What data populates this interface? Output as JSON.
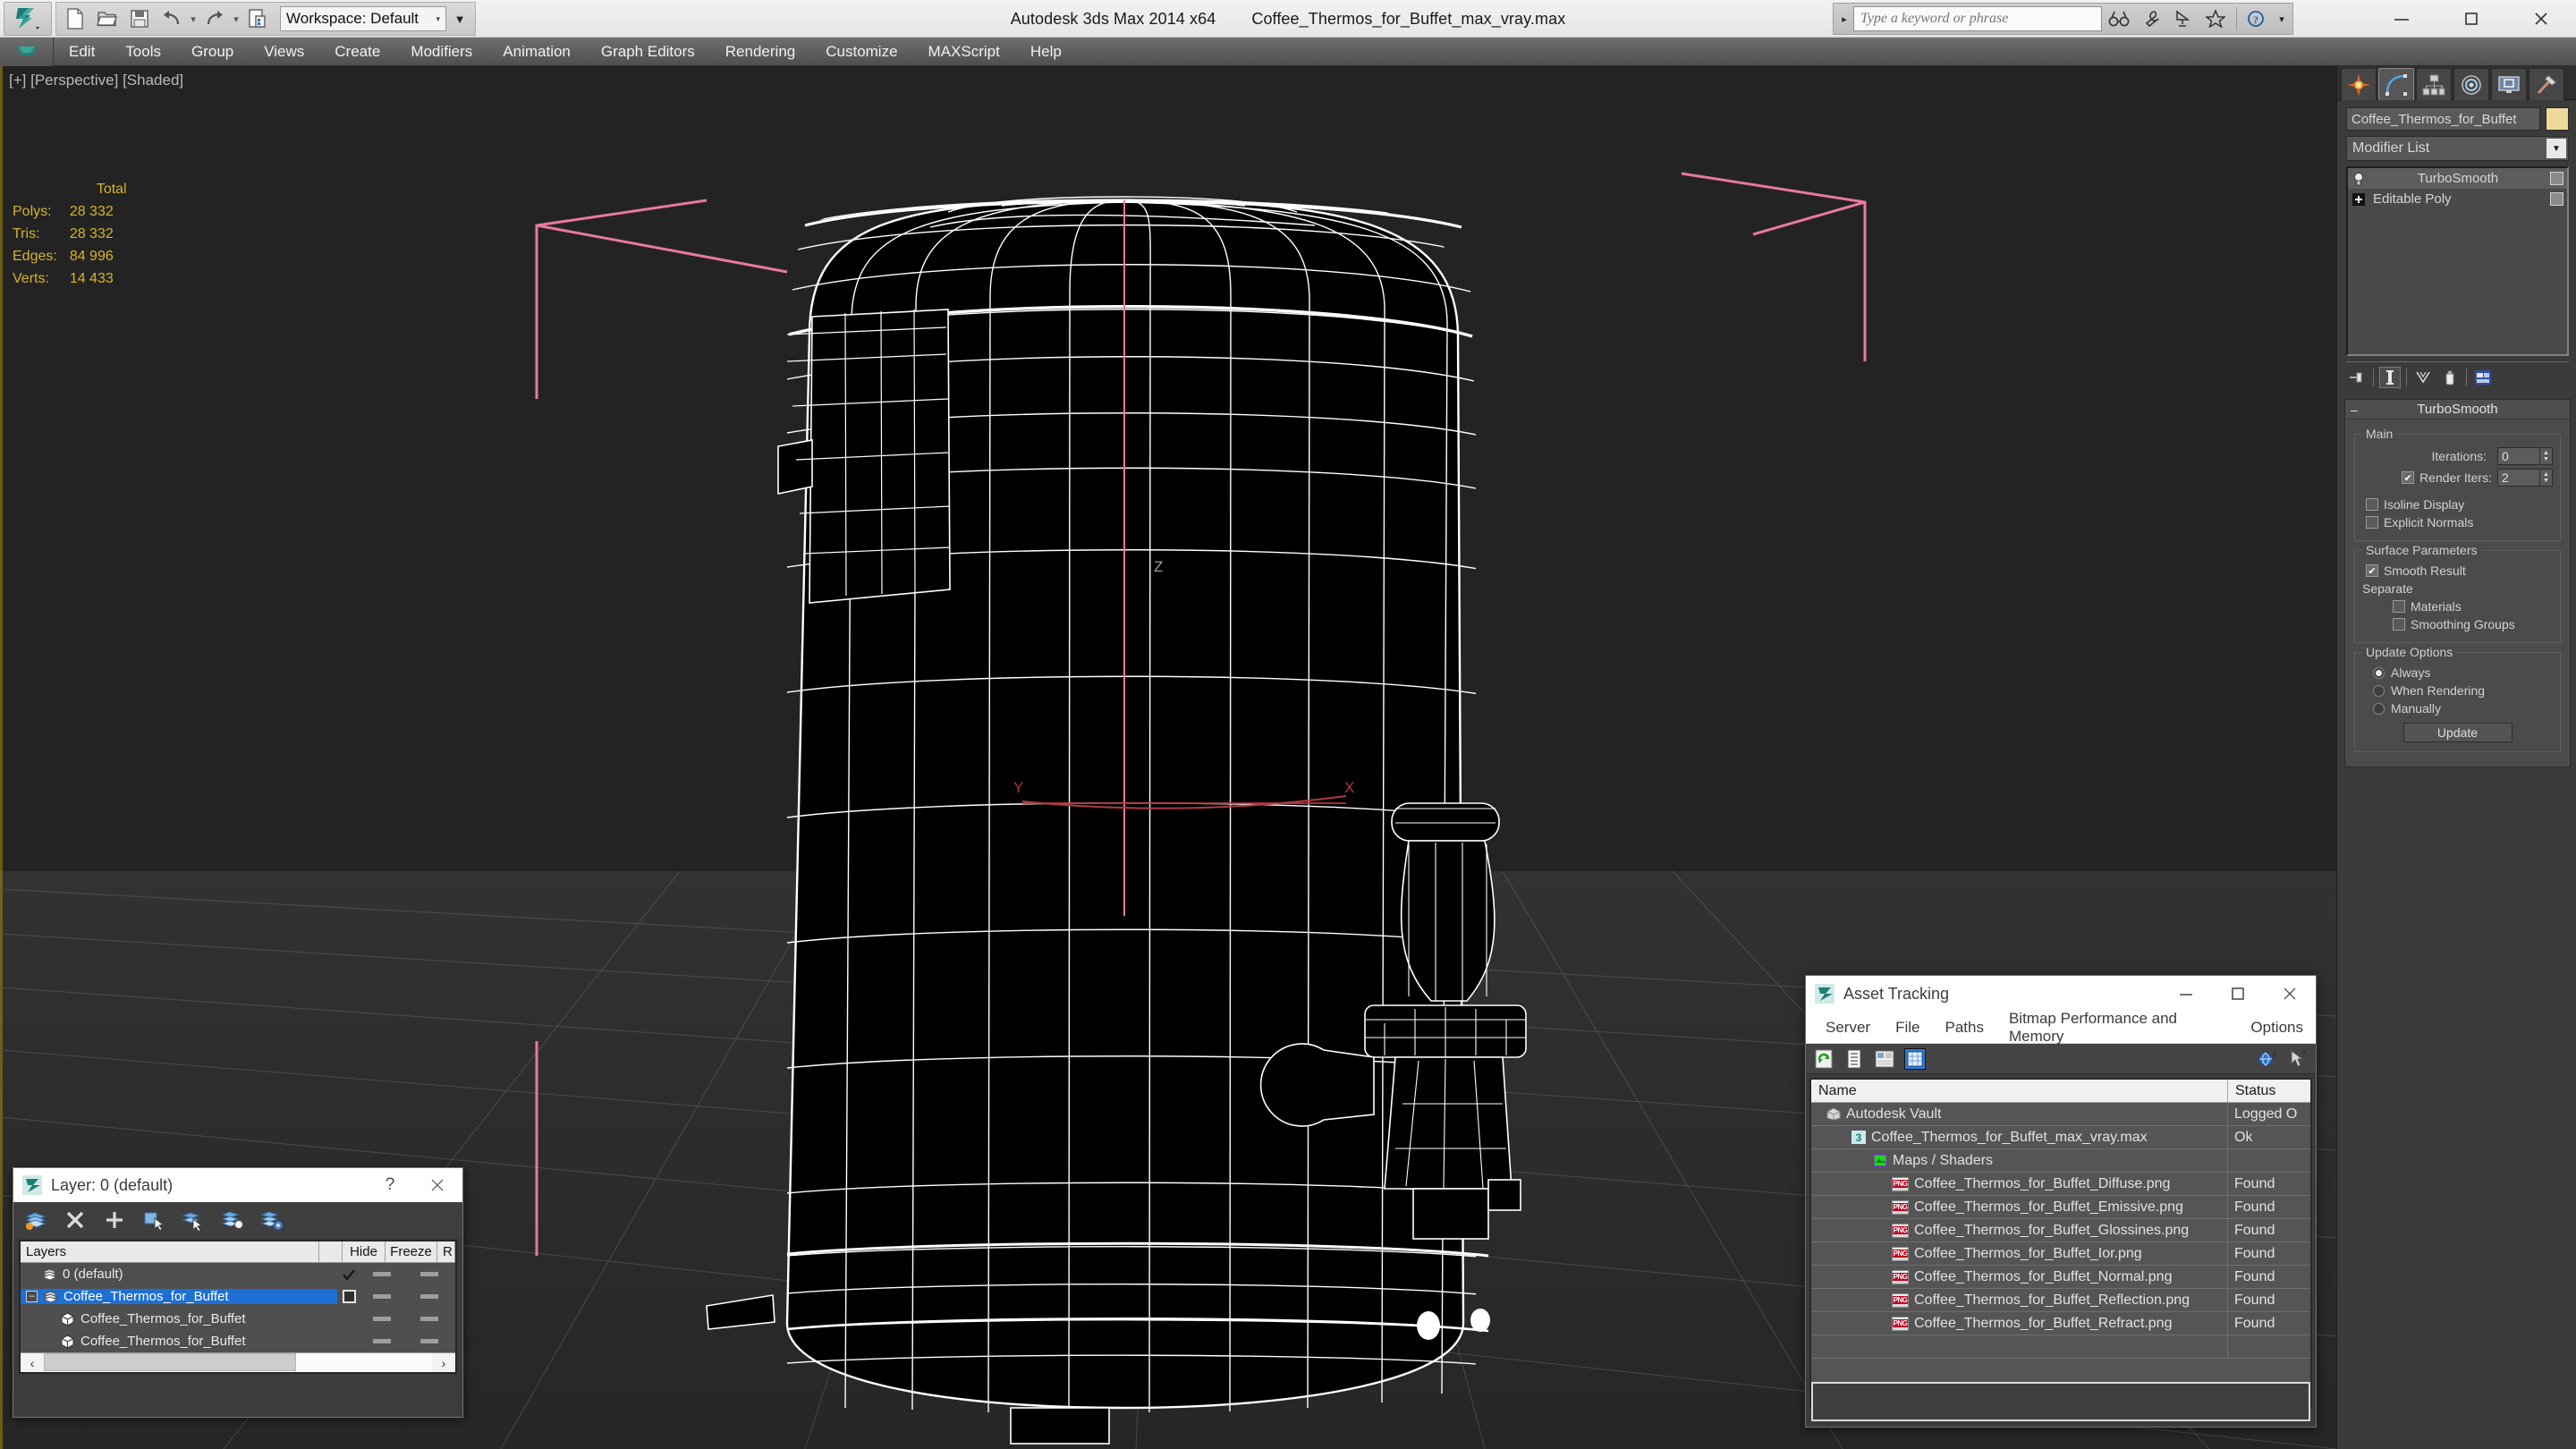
{
  "titlebar": {
    "app_title": "Autodesk 3ds Max  2014 x64",
    "file_title": "Coffee_Thermos_for_Buffet_max_vray.max",
    "workspace_label": "Workspace: Default",
    "search_placeholder": "Type a keyword or phrase",
    "quick_access": [
      {
        "name": "new-file",
        "label": "New"
      },
      {
        "name": "open-file",
        "label": "Open"
      },
      {
        "name": "save-file",
        "label": "Save"
      },
      {
        "name": "undo",
        "label": "Undo"
      },
      {
        "name": "redo",
        "label": "Redo"
      },
      {
        "name": "set-project-folder",
        "label": "Set Project Folder"
      }
    ],
    "help_icons": [
      "binoculars-icon",
      "wrench-icon",
      "satellite-icon",
      "star-icon",
      "help-icon"
    ],
    "window_controls": {
      "minimize": "–",
      "maximize": "☐",
      "close": "✕"
    }
  },
  "menubar": {
    "items": [
      "Edit",
      "Tools",
      "Group",
      "Views",
      "Create",
      "Modifiers",
      "Animation",
      "Graph Editors",
      "Rendering",
      "Customize",
      "MAXScript",
      "Help"
    ]
  },
  "viewport": {
    "label": "[+] [Perspective] [Shaded]",
    "stats": {
      "header": "Total",
      "rows": [
        {
          "label": "Polys:",
          "value": "28 332"
        },
        {
          "label": "Tris:",
          "value": "28 332"
        },
        {
          "label": "Edges:",
          "value": "84 996"
        },
        {
          "label": "Verts:",
          "value": "14 433"
        }
      ]
    },
    "axis_labels": {
      "z": "Z",
      "x": "X",
      "y": "Y"
    },
    "colors": {
      "background": "#232323",
      "wireframe": "#ffffff",
      "selection_bracket": "#e8799f",
      "grid": "#3a3a3a",
      "stats_text": "#d4b42a"
    }
  },
  "command_panel": {
    "tabs": [
      {
        "name": "create-tab",
        "label": "Create"
      },
      {
        "name": "modify-tab",
        "label": "Modify",
        "active": true
      },
      {
        "name": "hierarchy-tab",
        "label": "Hierarchy"
      },
      {
        "name": "motion-tab",
        "label": "Motion"
      },
      {
        "name": "display-tab",
        "label": "Display"
      },
      {
        "name": "utilities-tab",
        "label": "Utilities"
      }
    ],
    "object_name": "Coffee_Thermos_for_Buffet",
    "object_color": "#efd99a",
    "modifier_list_label": "Modifier List",
    "stack": [
      {
        "label": "TurboSmooth",
        "selected": true
      },
      {
        "label": "Editable Poly",
        "selected": false
      }
    ],
    "rollout": {
      "title": "TurboSmooth",
      "main_group": "Main",
      "iterations_label": "Iterations:",
      "iterations_value": "0",
      "render_iters_label": "Render Iters:",
      "render_iters_value": "2",
      "render_iters_checked": true,
      "isoline_label": "Isoline Display",
      "isoline_checked": false,
      "explicit_normals_label": "Explicit Normals",
      "explicit_normals_checked": false,
      "surface_group": "Surface Parameters",
      "smooth_result_label": "Smooth Result",
      "smooth_result_checked": true,
      "separate_label": "Separate",
      "materials_label": "Materials",
      "materials_checked": false,
      "smoothing_groups_label": "Smoothing Groups",
      "smoothing_groups_checked": false,
      "update_group": "Update Options",
      "update_options": [
        {
          "label": "Always",
          "selected": true
        },
        {
          "label": "When Rendering",
          "selected": false
        },
        {
          "label": "Manually",
          "selected": false
        }
      ],
      "update_button": "Update"
    }
  },
  "asset_tracking": {
    "title": "Asset Tracking",
    "menu": [
      "Server",
      "File",
      "Paths",
      "Bitmap Performance and Memory",
      "Options"
    ],
    "columns": {
      "name": "Name",
      "status": "Status"
    },
    "rows": [
      {
        "indent": 0,
        "icon": "vault-icon",
        "name": "Autodesk Vault",
        "status": "Logged O"
      },
      {
        "indent": 1,
        "icon": "max-icon",
        "name": "Coffee_Thermos_for_Buffet_max_vray.max",
        "status": "Ok"
      },
      {
        "indent": 2,
        "icon": "maps-icon",
        "name": "Maps / Shaders",
        "status": ""
      },
      {
        "indent": 3,
        "icon": "png-icon",
        "name": "Coffee_Thermos_for_Buffet_Diffuse.png",
        "status": "Found"
      },
      {
        "indent": 3,
        "icon": "png-icon",
        "name": "Coffee_Thermos_for_Buffet_Emissive.png",
        "status": "Found"
      },
      {
        "indent": 3,
        "icon": "png-icon",
        "name": "Coffee_Thermos_for_Buffet_Glossines.png",
        "status": "Found"
      },
      {
        "indent": 3,
        "icon": "png-icon",
        "name": "Coffee_Thermos_for_Buffet_Ior.png",
        "status": "Found"
      },
      {
        "indent": 3,
        "icon": "png-icon",
        "name": "Coffee_Thermos_for_Buffet_Normal.png",
        "status": "Found"
      },
      {
        "indent": 3,
        "icon": "png-icon",
        "name": "Coffee_Thermos_for_Buffet_Reflection.png",
        "status": "Found"
      },
      {
        "indent": 3,
        "icon": "png-icon",
        "name": "Coffee_Thermos_for_Buffet_Refract.png",
        "status": "Found"
      }
    ],
    "window_controls": {
      "minimize": "–",
      "maximize": "☐",
      "close": "✕"
    }
  },
  "layer_dialog": {
    "title": "Layer: 0 (default)",
    "help_glyph": "?",
    "close_glyph": "✕",
    "columns": {
      "layers": "Layers",
      "hide": "Hide",
      "freeze": "Freeze",
      "r": "R"
    },
    "rows": [
      {
        "indent": 1,
        "icon": "layer-icon",
        "name": "0 (default)",
        "current": true,
        "selected": false,
        "expander": false
      },
      {
        "indent": 0,
        "icon": "layer-icon",
        "name": "Coffee_Thermos_for_Buffet",
        "current": false,
        "selected": true,
        "expander": true
      },
      {
        "indent": 2,
        "icon": "object-icon",
        "name": "Coffee_Thermos_for_Buffet",
        "current": false,
        "selected": false,
        "expander": false
      },
      {
        "indent": 2,
        "icon": "object-icon",
        "name": "Coffee_Thermos_for_Buffet",
        "current": false,
        "selected": false,
        "expander": false
      }
    ],
    "toolbar": [
      "create-new-layer-icon",
      "delete-layer-icon",
      "add-selection-icon",
      "select-objects-icon",
      "select-highlighted-icon",
      "highlight-selected-icon",
      "layer-properties-icon"
    ]
  }
}
